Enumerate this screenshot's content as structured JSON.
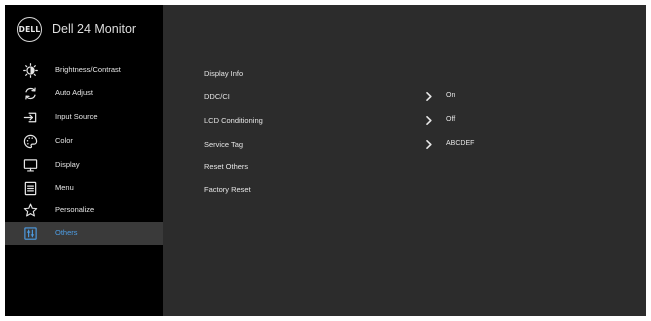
{
  "brand": {
    "logo_text": "DELL",
    "title": "Dell 24 Monitor"
  },
  "colors": {
    "osd_background": "#2c2c2c",
    "sidebar_background": "#000000",
    "active_item_background": "#3a3a3a",
    "active_accent": "#4e9ee6",
    "text": "#e6e6e6"
  },
  "sidebar": {
    "items": [
      {
        "label": "Brightness/Contrast",
        "icon": "brightness-icon",
        "active": false
      },
      {
        "label": "Auto Adjust",
        "icon": "auto-adjust-icon",
        "active": false
      },
      {
        "label": "Input Source",
        "icon": "input-source-icon",
        "active": false
      },
      {
        "label": "Color",
        "icon": "color-palette-icon",
        "active": false
      },
      {
        "label": "Display",
        "icon": "display-icon",
        "active": false
      },
      {
        "label": "Menu",
        "icon": "menu-icon",
        "active": false
      },
      {
        "label": "Personalize",
        "icon": "star-icon",
        "active": false
      },
      {
        "label": "Others",
        "icon": "others-icon",
        "active": true
      }
    ]
  },
  "content": {
    "rows": [
      {
        "label": "Display Info",
        "has_submenu": false,
        "value": ""
      },
      {
        "label": "DDC/CI",
        "has_submenu": true,
        "value": "On"
      },
      {
        "label": "LCD Conditioning",
        "has_submenu": true,
        "value": "Off"
      },
      {
        "label": "Service Tag",
        "has_submenu": true,
        "value": "ABCDEF"
      },
      {
        "label": "Reset Others",
        "has_submenu": false,
        "value": ""
      },
      {
        "label": "Factory Reset",
        "has_submenu": false,
        "value": ""
      }
    ]
  }
}
